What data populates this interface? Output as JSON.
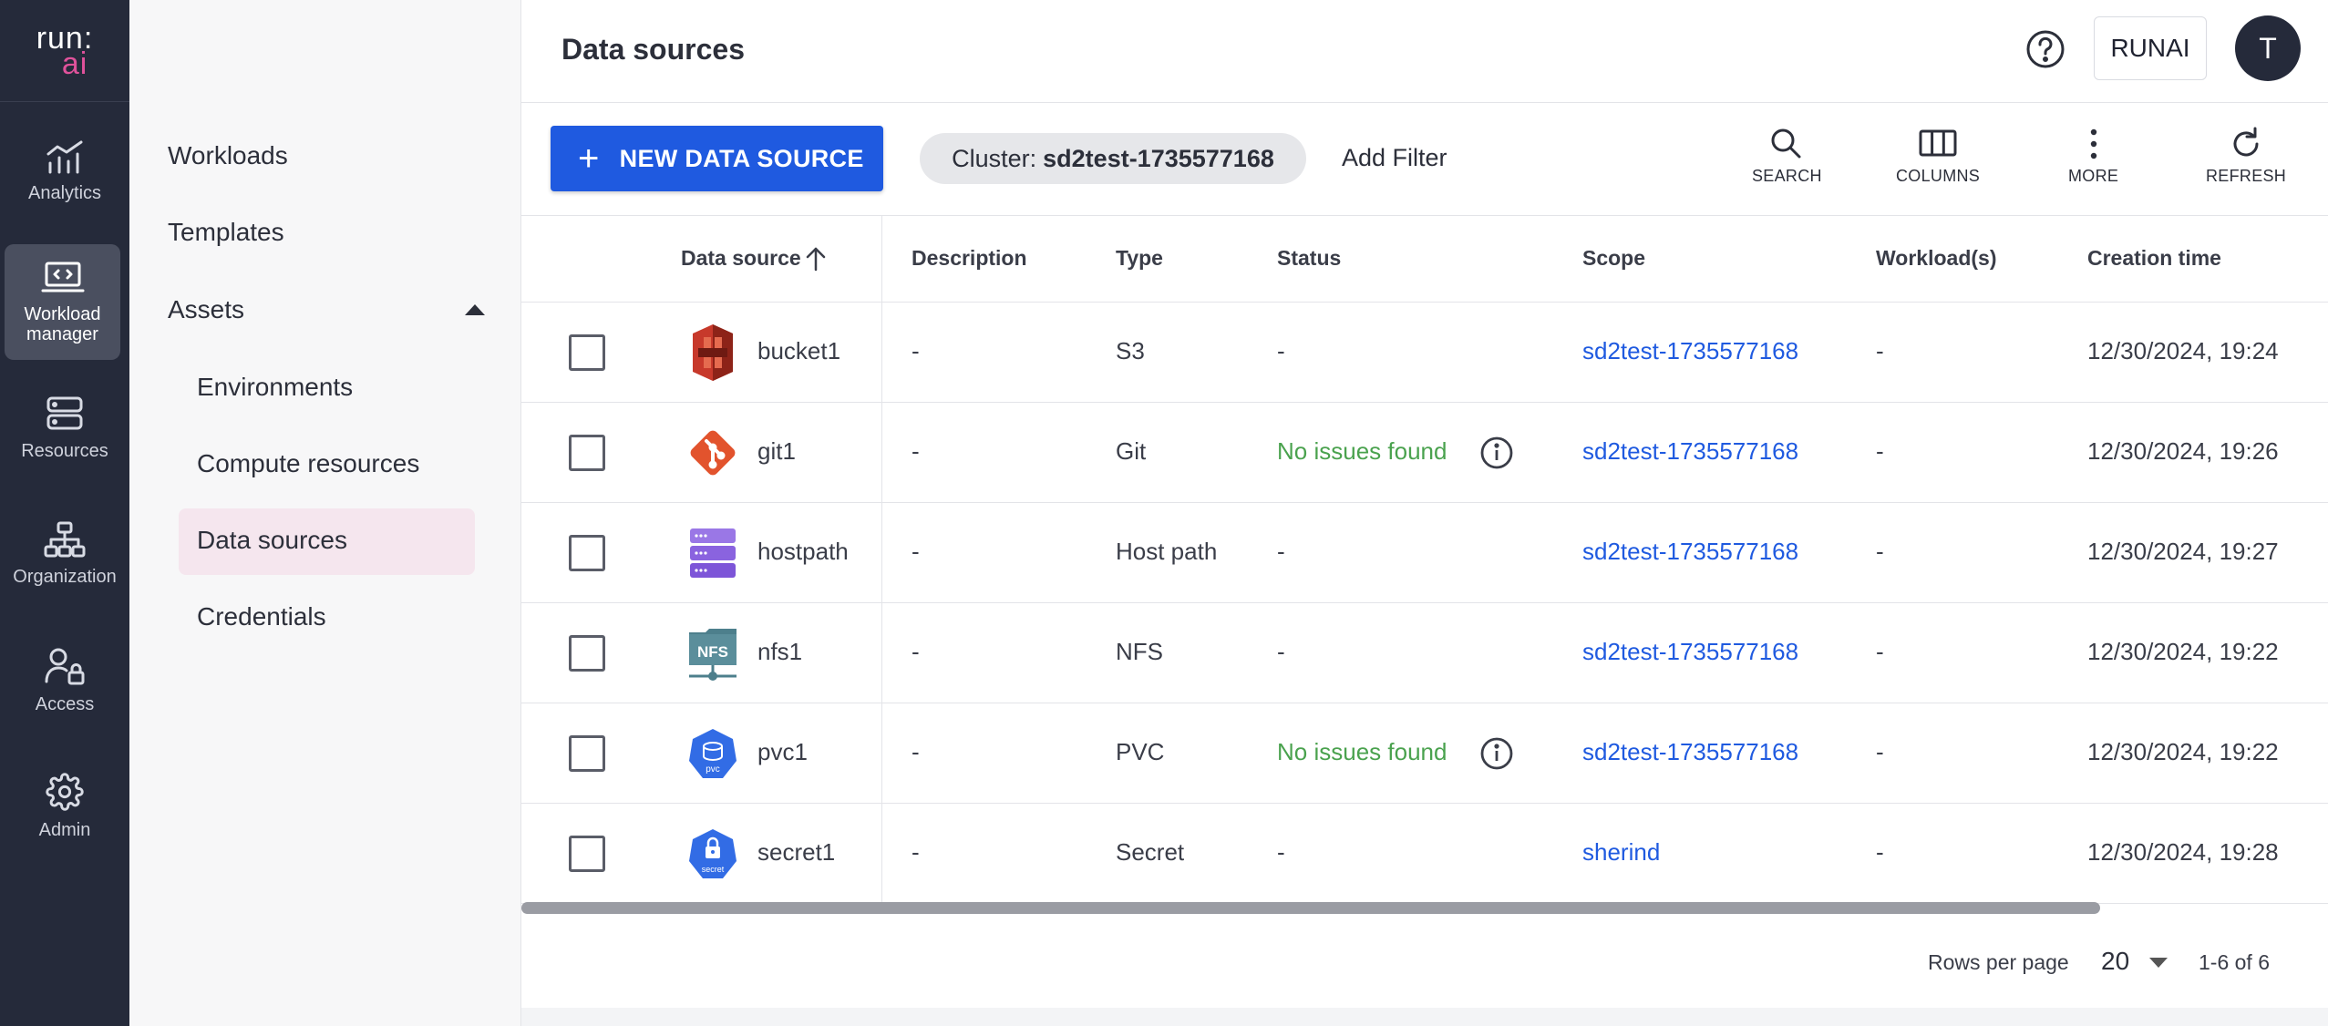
{
  "brand": {
    "logo_top": "run:",
    "logo_bottom": "ai"
  },
  "rail": {
    "items": [
      {
        "label": "Analytics",
        "icon": "analytics-icon"
      },
      {
        "label": "Workload manager",
        "icon": "workload-manager-icon",
        "active": true
      },
      {
        "label": "Resources",
        "icon": "resources-icon"
      },
      {
        "label": "Organization",
        "icon": "organization-icon"
      },
      {
        "label": "Access",
        "icon": "access-icon"
      },
      {
        "label": "Admin",
        "icon": "gear-icon"
      }
    ]
  },
  "subnav": {
    "workloads": "Workloads",
    "templates": "Templates",
    "assets": "Assets",
    "environments": "Environments",
    "compute_resources": "Compute resources",
    "data_sources": "Data sources",
    "credentials": "Credentials",
    "active": "Data sources"
  },
  "header": {
    "title": "Data sources",
    "tenant_button": "RUNAI",
    "avatar_initial": "T"
  },
  "toolbar": {
    "new_button": "NEW DATA SOURCE",
    "cluster_label": "Cluster:",
    "cluster_value": "sd2test-1735577168",
    "add_filter": "Add Filter",
    "search": "SEARCH",
    "columns": "COLUMNS",
    "more": "MORE",
    "refresh": "REFRESH"
  },
  "table": {
    "columns": [
      "Data source",
      "Description",
      "Type",
      "Status",
      "Scope",
      "Workload(s)",
      "Creation time"
    ],
    "sort": {
      "column": "Data source",
      "direction": "ascending"
    },
    "rows": [
      {
        "name": "bucket1",
        "icon": "s3-bucket-icon",
        "description": "-",
        "type": "S3",
        "status": "-",
        "scope": "sd2test-1735577168",
        "workloads": "-",
        "created": "12/30/2024, 19:24"
      },
      {
        "name": "git1",
        "icon": "git-icon",
        "description": "-",
        "type": "Git",
        "status": "No issues found",
        "scope": "sd2test-1735577168",
        "workloads": "-",
        "created": "12/30/2024, 19:26"
      },
      {
        "name": "hostpath",
        "icon": "host-path-icon",
        "description": "-",
        "type": "Host path",
        "status": "-",
        "scope": "sd2test-1735577168",
        "workloads": "-",
        "created": "12/30/2024, 19:27"
      },
      {
        "name": "nfs1",
        "icon": "nfs-icon",
        "description": "-",
        "type": "NFS",
        "status": "-",
        "scope": "sd2test-1735577168",
        "workloads": "-",
        "created": "12/30/2024, 19:22"
      },
      {
        "name": "pvc1",
        "icon": "pvc-icon",
        "description": "-",
        "type": "PVC",
        "status": "No issues found",
        "scope": "sd2test-1735577168",
        "workloads": "-",
        "created": "12/30/2024, 19:22"
      },
      {
        "name": "secret1",
        "icon": "secret-icon",
        "description": "-",
        "type": "Secret",
        "status": "-",
        "scope": "sherind",
        "workloads": "-",
        "created": "12/30/2024, 19:28"
      }
    ]
  },
  "footer": {
    "rows_per_page_label": "Rows per page",
    "rows_per_page": "20",
    "range": "1-6 of 6"
  },
  "colors": {
    "primary": "#1f5ae0",
    "rail_bg": "#252a3a",
    "status_ok": "#4aa24e",
    "active_nav_bg": "#f5e6ee",
    "logo_accent": "#e0529b"
  }
}
